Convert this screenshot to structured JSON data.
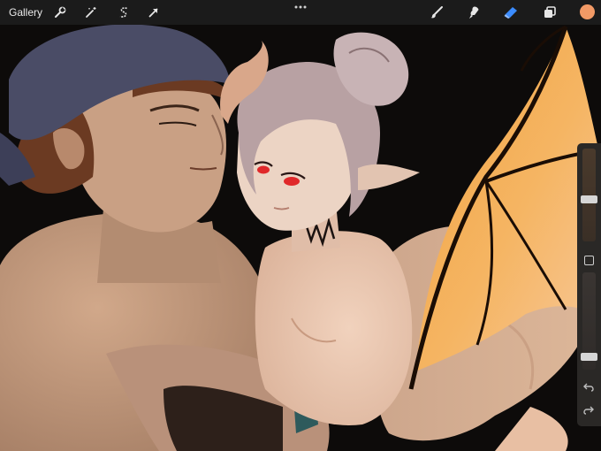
{
  "toolbar": {
    "gallery_label": "Gallery",
    "left_tools": [
      {
        "name": "actions",
        "icon": "wrench-icon"
      },
      {
        "name": "adjustments",
        "icon": "magic-wand-icon"
      },
      {
        "name": "selection",
        "icon": "selection-s-icon"
      },
      {
        "name": "transform",
        "icon": "arrow-cursor-icon"
      }
    ],
    "right_tools": [
      {
        "name": "brush",
        "icon": "brush-icon",
        "active": false
      },
      {
        "name": "smudge",
        "icon": "smudge-finger-icon",
        "active": false
      },
      {
        "name": "eraser",
        "icon": "eraser-icon",
        "active": true
      },
      {
        "name": "layers",
        "icon": "layers-icon",
        "active": false
      }
    ],
    "current_color": "#f29a66",
    "accent_color": "#3b8cff"
  },
  "sidebar": {
    "brush_size_level": 0.45,
    "opacity_level": 0.1,
    "undo_icon": "undo-arrow-icon",
    "redo_icon": "redo-arrow-icon"
  },
  "canvas": {
    "background_color": "#0d0b0a",
    "skin_tone": "#c9a184",
    "bandana_color": "#4a4c66",
    "hair_color_man": "#6b3a22",
    "hair_color_girl": "#b8a1a3",
    "wing_color": "#f5a24a",
    "eye_color": "#e0282a"
  }
}
